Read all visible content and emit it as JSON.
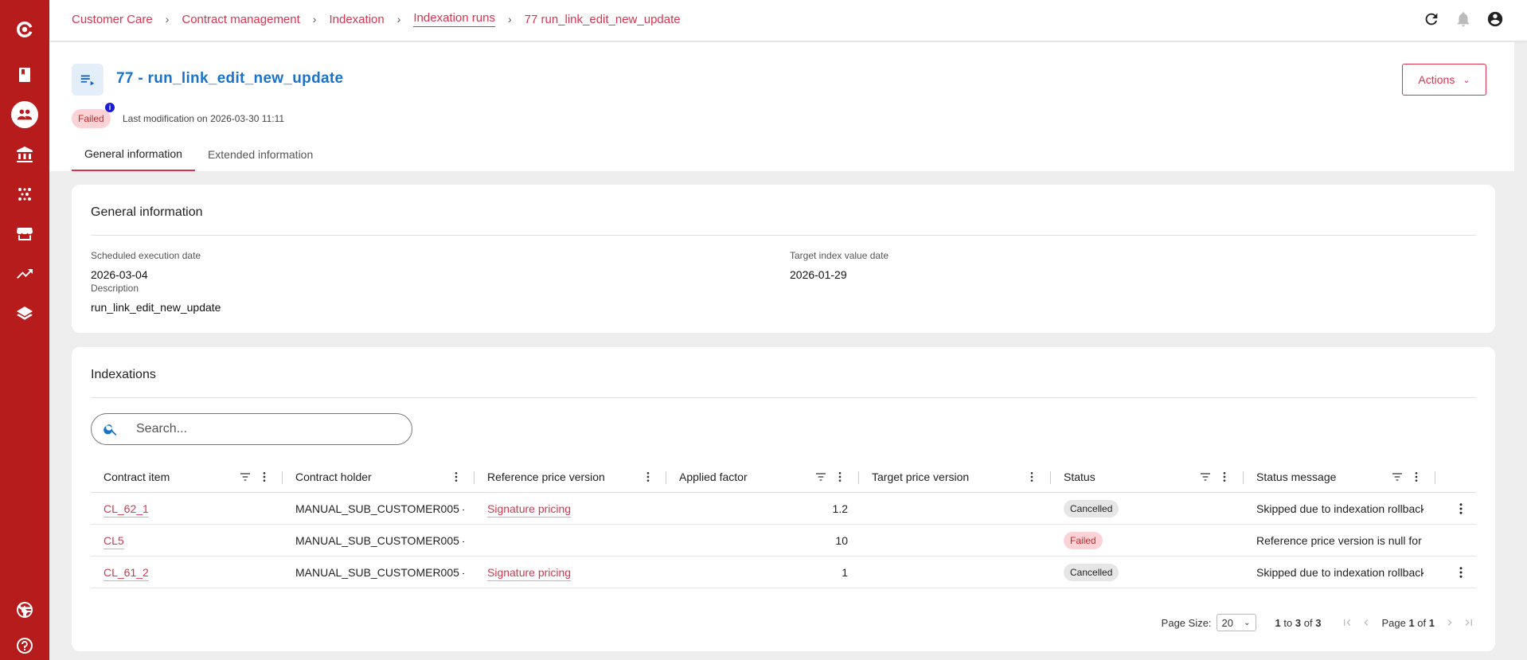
{
  "breadcrumb": [
    {
      "label": "Customer Care"
    },
    {
      "label": "Contract management"
    },
    {
      "label": "Indexation"
    },
    {
      "label": "Indexation runs"
    },
    {
      "label": "77 run_link_edit_new_update"
    }
  ],
  "header": {
    "title": "77 - run_link_edit_new_update",
    "status": "Failed",
    "info_badge": "i",
    "last_modification": "Last modification on 2026-03-30 11:11",
    "actions_label": "Actions"
  },
  "tabs": [
    {
      "label": "General information",
      "active": true
    },
    {
      "label": "Extended information",
      "active": false
    }
  ],
  "general": {
    "title": "General information",
    "scheduled_label": "Scheduled execution date",
    "scheduled_value": "2026-03-04",
    "target_label": "Target index value date",
    "target_value": "2026-01-29",
    "description_label": "Description",
    "description_value": "run_link_edit_new_update"
  },
  "indexations": {
    "title": "Indexations",
    "search_placeholder": "Search...",
    "columns": {
      "contract_item": "Contract item",
      "contract_holder": "Contract holder",
      "reference_price_version": "Reference price version",
      "applied_factor": "Applied factor",
      "target_price_version": "Target price version",
      "status": "Status",
      "status_message": "Status message"
    },
    "rows": [
      {
        "contract_item": "CL_62_1",
        "contract_holder": "MANUAL_SUB_CUSTOMER005 -",
        "reference_price_version": "Signature pricing",
        "applied_factor": "1.2",
        "target_price_version": "",
        "status": "Cancelled",
        "status_message": "Skipped due to indexation rollback"
      },
      {
        "contract_item": "CL5",
        "contract_holder": "MANUAL_SUB_CUSTOMER005 -",
        "reference_price_version": "",
        "applied_factor": "10",
        "target_price_version": "",
        "status": "Failed",
        "status_message": "Reference price version is null for"
      },
      {
        "contract_item": "CL_61_2",
        "contract_holder": "MANUAL_SUB_CUSTOMER005 -",
        "reference_price_version": "Signature pricing",
        "applied_factor": "1",
        "target_price_version": "",
        "status": "Cancelled",
        "status_message": "Skipped due to indexation rollback"
      }
    ],
    "pager": {
      "page_size_label": "Page Size:",
      "page_size": "20",
      "range_from": "1",
      "range_to_word": "to",
      "range_to": "3",
      "range_of_word": "of",
      "total": "3",
      "page_word": "Page",
      "page": "1",
      "page_of_word": "of",
      "pages": "1"
    }
  },
  "colors": {
    "sidebar": "#b71c1c",
    "accent": "#d8344f",
    "title_blue": "#1a73c8"
  }
}
